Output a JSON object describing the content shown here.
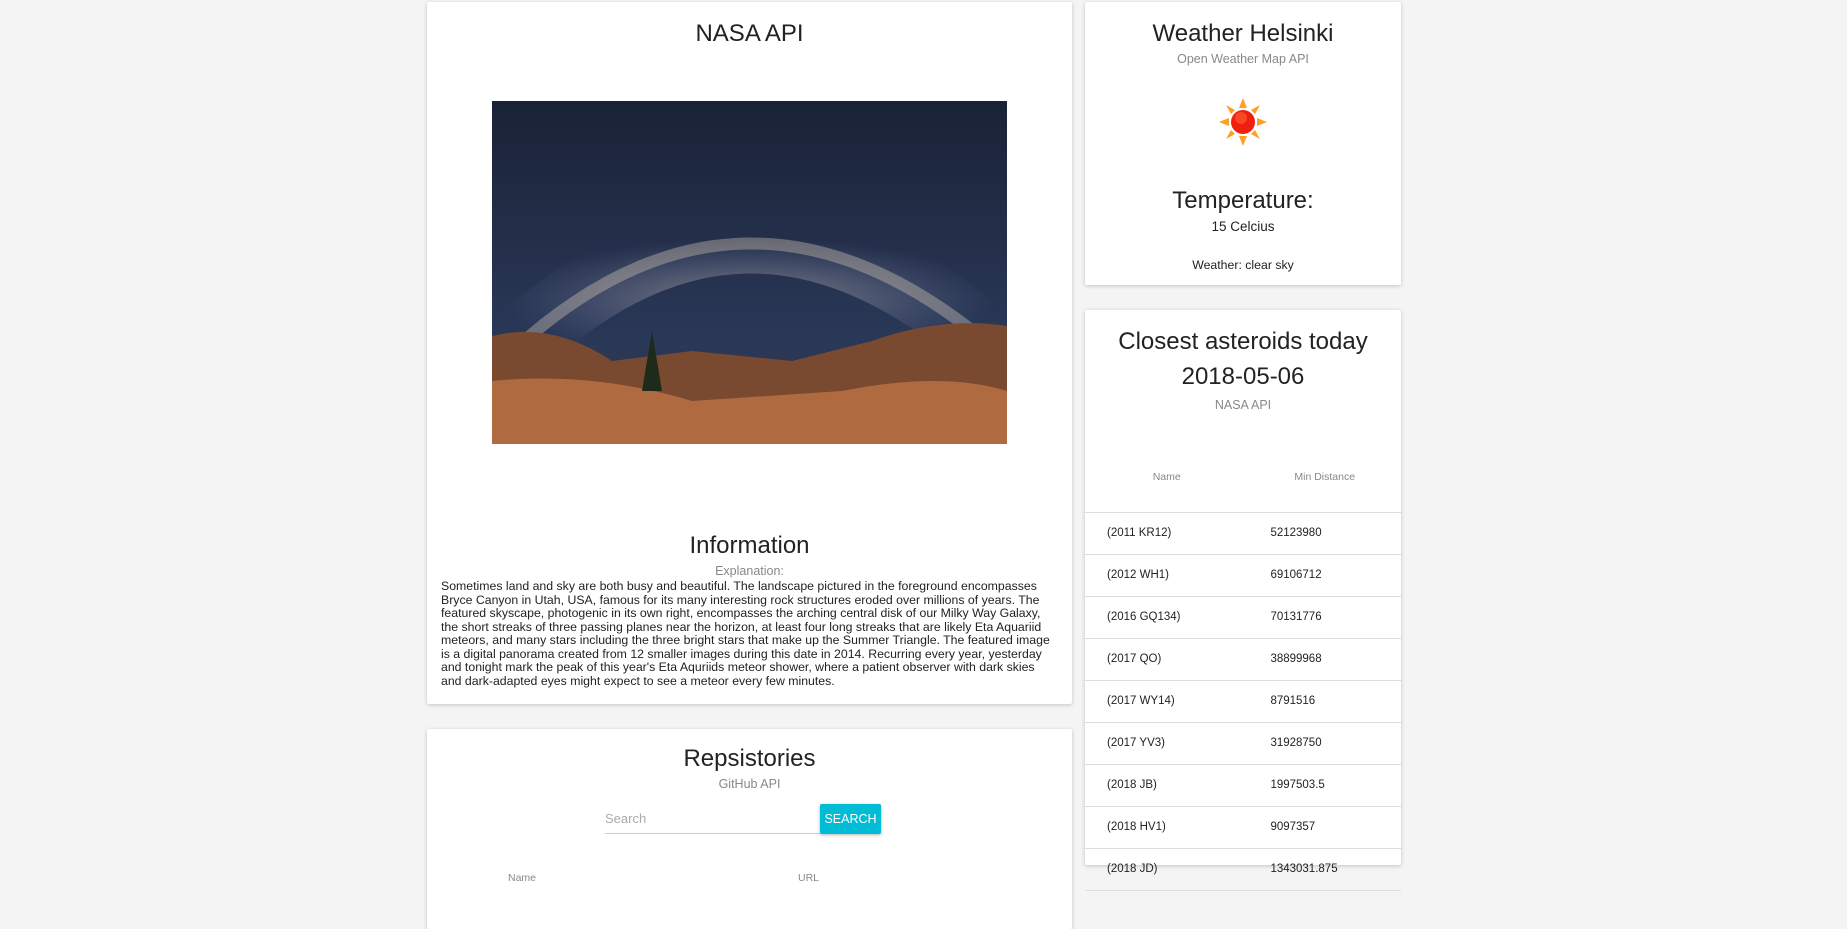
{
  "nasa": {
    "title": "NASA API",
    "info_title": "Information",
    "info_sub": "Explanation:",
    "explanation": "Sometimes land and sky are both busy and beautiful. The landscape pictured in the foreground encompasses Bryce Canyon in Utah, USA, famous for its many interesting rock structures eroded over millions of years. The featured skyscape, photogenic in its own right, encompasses the arching central disk of our Milky Way Galaxy, the short streaks of three passing planes near the horizon, at least four long streaks that are likely Eta Aquariid meteors, and many stars including the three bright stars that make up the Summer Triangle. The featured image is a digital panorama created from 12 smaller images during this date in 2014. Recurring every year, yesterday and tonight mark the peak of this year's Eta Aquriids meteor shower, where a patient observer with dark skies and dark-adapted eyes might expect to see a meteor every few minutes."
  },
  "weather": {
    "title": "Weather Helsinki",
    "sub": "Open Weather Map API",
    "icon": "sun-icon",
    "temp_label": "Temperature:",
    "temp_value": "15 Celcius",
    "description": "Weather: clear sky"
  },
  "asteroids": {
    "title": "Closest asteroids today 2018-05-06",
    "sub": "NASA API",
    "headers": [
      "Name",
      "Min Distance"
    ],
    "rows": [
      [
        "(2011 KR12)",
        "52123980"
      ],
      [
        "(2012 WH1)",
        "69106712"
      ],
      [
        "(2016 GQ134)",
        "70131776"
      ],
      [
        "(2017 QO)",
        "38899968"
      ],
      [
        "(2017 WY14)",
        "8791516"
      ],
      [
        "(2017 YV3)",
        "31928750"
      ],
      [
        "(2018 JB)",
        "1997503.5"
      ],
      [
        "(2018 HV1)",
        "9097357"
      ],
      [
        "(2018 JD)",
        "1343031.875"
      ]
    ]
  },
  "repos": {
    "title": "Repsistories",
    "sub": "GitHub API",
    "search_placeholder": "Search",
    "search_label": "SEARCH",
    "headers": [
      "Name",
      "URL"
    ]
  },
  "colors": {
    "accent": "#00bcd4"
  }
}
